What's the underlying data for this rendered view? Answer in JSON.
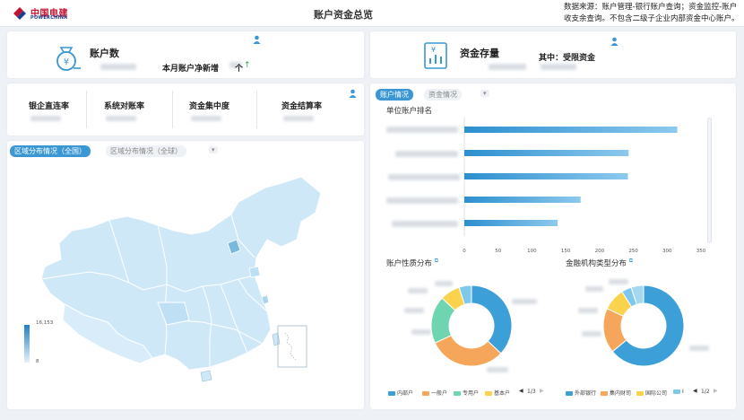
{
  "header": {
    "logo_cn": "中国电建",
    "logo_en": "POWERCHINA",
    "title": "账户资金总览",
    "note": "数据来源：账户管理-银行账户查询；资金监控-账户收支余查询。不包含二级子企业内部资金中心账户。"
  },
  "kpi": {
    "accounts_label": "账户数",
    "net_new_label": "本月账户净新增",
    "net_new_suffix": "个",
    "net_new_arrow": "↑",
    "funds_label": "资金存量",
    "restricted_label": "其中：受限资金"
  },
  "metrics": [
    "银企直连率",
    "系统对账率",
    "资金集中度",
    "资金结算率"
  ],
  "region_tabs": {
    "tab1": "区域分布情况（全国）",
    "tab2": "区域分布情况（全球）",
    "more": "▾"
  },
  "map_legend": {
    "max": "16,153",
    "min": "8"
  },
  "right_tabs": {
    "tab1": "账户情况",
    "tab2": "资金情况",
    "more": "▾"
  },
  "ranking": {
    "title": "单位账户排名"
  },
  "chart_data": [
    {
      "type": "bar",
      "title": "单位账户排名",
      "orientation": "horizontal",
      "values": [
        315,
        243,
        242,
        172,
        138
      ],
      "xlim": [
        0,
        350
      ],
      "xticks": [
        0,
        50,
        100,
        150,
        200,
        250,
        300,
        350
      ]
    },
    {
      "type": "pie",
      "title": "账户性质分布",
      "donut": true,
      "labels": [
        "内部户",
        "一般户",
        "专用户",
        "基本户"
      ],
      "values": [
        37,
        31,
        19,
        8
      ],
      "other_value": 5,
      "colors": [
        "#3d9fd8",
        "#f6a65a",
        "#6fd4b0",
        "#fad24b"
      ],
      "other_color": "#7ec8ec",
      "legend_page": "1/3"
    },
    {
      "type": "pie",
      "title": "金融机构类型分布",
      "donut": true,
      "labels": [
        "外部银行",
        "集内财司",
        "国际公司",
        "I"
      ],
      "values": [
        64,
        18,
        9,
        4
      ],
      "other_value": 5,
      "colors": [
        "#3d9fd8",
        "#f6a65a",
        "#fad24b",
        "#7ec8ec"
      ],
      "other_color": "#a3d8f0",
      "legend_page": "1/2"
    }
  ]
}
